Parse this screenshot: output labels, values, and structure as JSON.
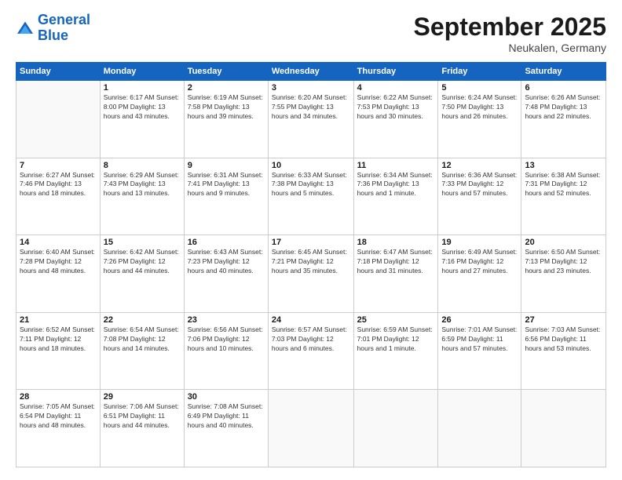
{
  "header": {
    "logo_line1": "General",
    "logo_line2": "Blue",
    "month_year": "September 2025",
    "location": "Neukalen, Germany"
  },
  "weekdays": [
    "Sunday",
    "Monday",
    "Tuesday",
    "Wednesday",
    "Thursday",
    "Friday",
    "Saturday"
  ],
  "weeks": [
    [
      {
        "day": "",
        "info": ""
      },
      {
        "day": "1",
        "info": "Sunrise: 6:17 AM\nSunset: 8:00 PM\nDaylight: 13 hours\nand 43 minutes."
      },
      {
        "day": "2",
        "info": "Sunrise: 6:19 AM\nSunset: 7:58 PM\nDaylight: 13 hours\nand 39 minutes."
      },
      {
        "day": "3",
        "info": "Sunrise: 6:20 AM\nSunset: 7:55 PM\nDaylight: 13 hours\nand 34 minutes."
      },
      {
        "day": "4",
        "info": "Sunrise: 6:22 AM\nSunset: 7:53 PM\nDaylight: 13 hours\nand 30 minutes."
      },
      {
        "day": "5",
        "info": "Sunrise: 6:24 AM\nSunset: 7:50 PM\nDaylight: 13 hours\nand 26 minutes."
      },
      {
        "day": "6",
        "info": "Sunrise: 6:26 AM\nSunset: 7:48 PM\nDaylight: 13 hours\nand 22 minutes."
      }
    ],
    [
      {
        "day": "7",
        "info": "Sunrise: 6:27 AM\nSunset: 7:46 PM\nDaylight: 13 hours\nand 18 minutes."
      },
      {
        "day": "8",
        "info": "Sunrise: 6:29 AM\nSunset: 7:43 PM\nDaylight: 13 hours\nand 13 minutes."
      },
      {
        "day": "9",
        "info": "Sunrise: 6:31 AM\nSunset: 7:41 PM\nDaylight: 13 hours\nand 9 minutes."
      },
      {
        "day": "10",
        "info": "Sunrise: 6:33 AM\nSunset: 7:38 PM\nDaylight: 13 hours\nand 5 minutes."
      },
      {
        "day": "11",
        "info": "Sunrise: 6:34 AM\nSunset: 7:36 PM\nDaylight: 13 hours\nand 1 minute."
      },
      {
        "day": "12",
        "info": "Sunrise: 6:36 AM\nSunset: 7:33 PM\nDaylight: 12 hours\nand 57 minutes."
      },
      {
        "day": "13",
        "info": "Sunrise: 6:38 AM\nSunset: 7:31 PM\nDaylight: 12 hours\nand 52 minutes."
      }
    ],
    [
      {
        "day": "14",
        "info": "Sunrise: 6:40 AM\nSunset: 7:28 PM\nDaylight: 12 hours\nand 48 minutes."
      },
      {
        "day": "15",
        "info": "Sunrise: 6:42 AM\nSunset: 7:26 PM\nDaylight: 12 hours\nand 44 minutes."
      },
      {
        "day": "16",
        "info": "Sunrise: 6:43 AM\nSunset: 7:23 PM\nDaylight: 12 hours\nand 40 minutes."
      },
      {
        "day": "17",
        "info": "Sunrise: 6:45 AM\nSunset: 7:21 PM\nDaylight: 12 hours\nand 35 minutes."
      },
      {
        "day": "18",
        "info": "Sunrise: 6:47 AM\nSunset: 7:18 PM\nDaylight: 12 hours\nand 31 minutes."
      },
      {
        "day": "19",
        "info": "Sunrise: 6:49 AM\nSunset: 7:16 PM\nDaylight: 12 hours\nand 27 minutes."
      },
      {
        "day": "20",
        "info": "Sunrise: 6:50 AM\nSunset: 7:13 PM\nDaylight: 12 hours\nand 23 minutes."
      }
    ],
    [
      {
        "day": "21",
        "info": "Sunrise: 6:52 AM\nSunset: 7:11 PM\nDaylight: 12 hours\nand 18 minutes."
      },
      {
        "day": "22",
        "info": "Sunrise: 6:54 AM\nSunset: 7:08 PM\nDaylight: 12 hours\nand 14 minutes."
      },
      {
        "day": "23",
        "info": "Sunrise: 6:56 AM\nSunset: 7:06 PM\nDaylight: 12 hours\nand 10 minutes."
      },
      {
        "day": "24",
        "info": "Sunrise: 6:57 AM\nSunset: 7:03 PM\nDaylight: 12 hours\nand 6 minutes."
      },
      {
        "day": "25",
        "info": "Sunrise: 6:59 AM\nSunset: 7:01 PM\nDaylight: 12 hours\nand 1 minute."
      },
      {
        "day": "26",
        "info": "Sunrise: 7:01 AM\nSunset: 6:59 PM\nDaylight: 11 hours\nand 57 minutes."
      },
      {
        "day": "27",
        "info": "Sunrise: 7:03 AM\nSunset: 6:56 PM\nDaylight: 11 hours\nand 53 minutes."
      }
    ],
    [
      {
        "day": "28",
        "info": "Sunrise: 7:05 AM\nSunset: 6:54 PM\nDaylight: 11 hours\nand 48 minutes."
      },
      {
        "day": "29",
        "info": "Sunrise: 7:06 AM\nSunset: 6:51 PM\nDaylight: 11 hours\nand 44 minutes."
      },
      {
        "day": "30",
        "info": "Sunrise: 7:08 AM\nSunset: 6:49 PM\nDaylight: 11 hours\nand 40 minutes."
      },
      {
        "day": "",
        "info": ""
      },
      {
        "day": "",
        "info": ""
      },
      {
        "day": "",
        "info": ""
      },
      {
        "day": "",
        "info": ""
      }
    ]
  ]
}
